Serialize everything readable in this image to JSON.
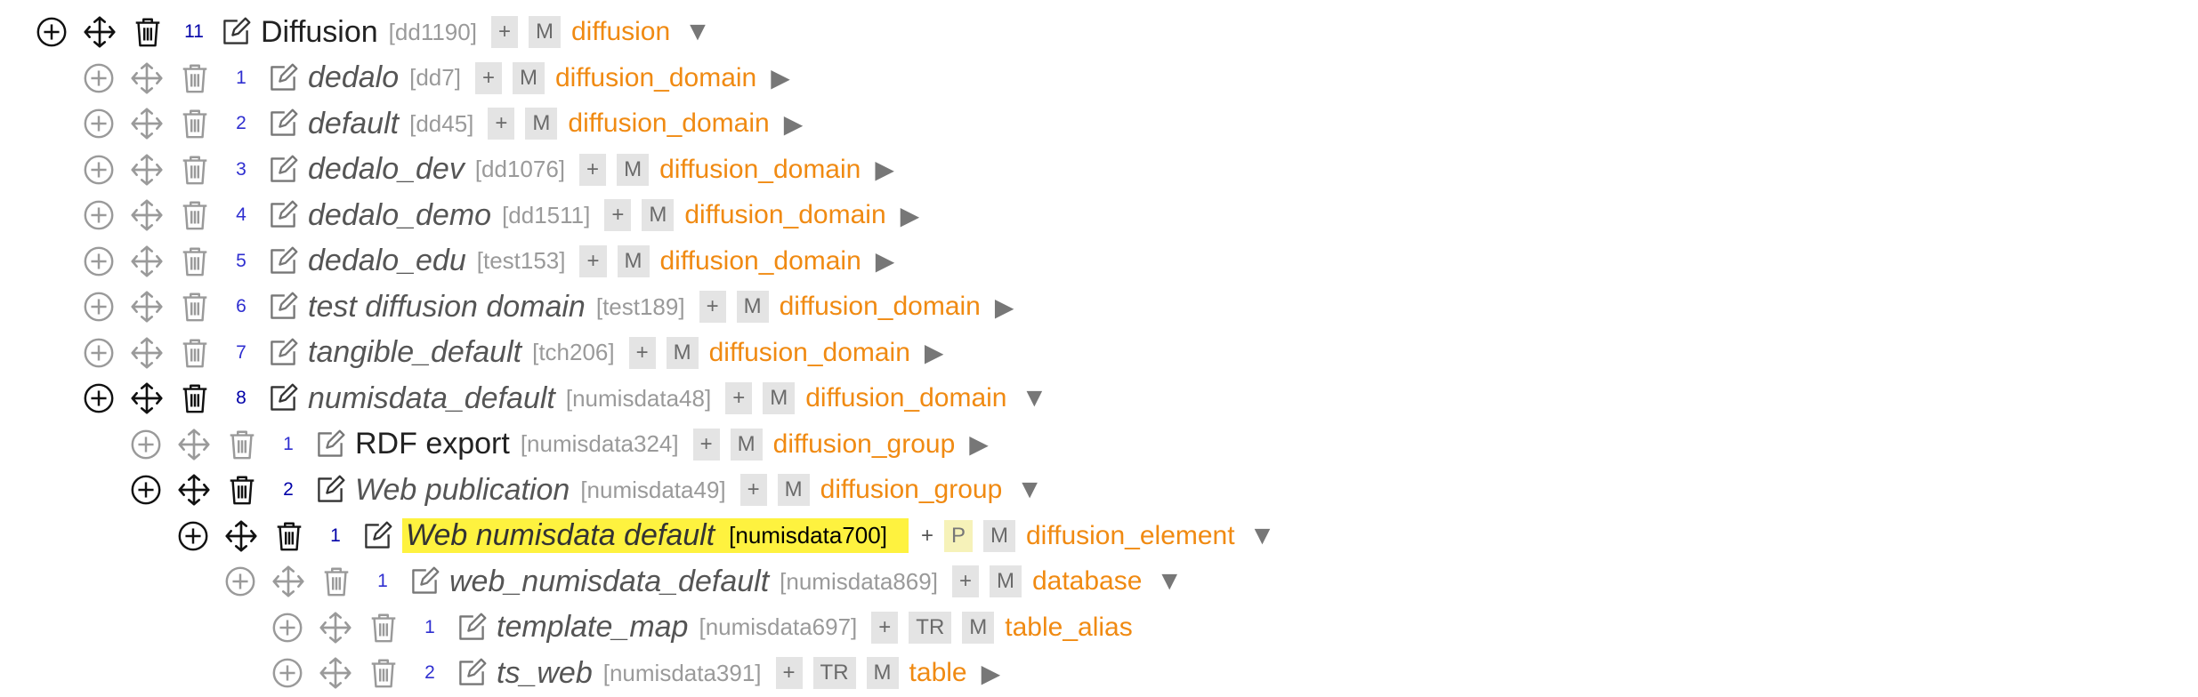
{
  "tree": {
    "rows": [
      {
        "indent": 0,
        "state": "active",
        "num": "11",
        "label": "Diffusion",
        "style": "plain",
        "tid": "[dd1190]",
        "badges": [
          "+",
          "M"
        ],
        "model": "diffusion",
        "arrow": "▼"
      },
      {
        "indent": 1,
        "state": "faded",
        "num": "1",
        "label": "dedalo",
        "style": "italic",
        "tid": "[dd7]",
        "badges": [
          "+",
          "M"
        ],
        "model": "diffusion_domain",
        "arrow": "▶"
      },
      {
        "indent": 1,
        "state": "faded",
        "num": "2",
        "label": "default",
        "style": "italic",
        "tid": "[dd45]",
        "badges": [
          "+",
          "M"
        ],
        "model": "diffusion_domain",
        "arrow": "▶"
      },
      {
        "indent": 1,
        "state": "faded",
        "num": "3",
        "label": "dedalo_dev",
        "style": "italic",
        "tid": "[dd1076]",
        "badges": [
          "+",
          "M"
        ],
        "model": "diffusion_domain",
        "arrow": "▶"
      },
      {
        "indent": 1,
        "state": "faded",
        "num": "4",
        "label": "dedalo_demo",
        "style": "italic",
        "tid": "[dd1511]",
        "badges": [
          "+",
          "M"
        ],
        "model": "diffusion_domain",
        "arrow": "▶"
      },
      {
        "indent": 1,
        "state": "faded",
        "num": "5",
        "label": "dedalo_edu",
        "style": "italic",
        "tid": "[test153]",
        "badges": [
          "+",
          "M"
        ],
        "model": "diffusion_domain",
        "arrow": "▶"
      },
      {
        "indent": 1,
        "state": "faded",
        "num": "6",
        "label": "test diffusion domain",
        "style": "italic",
        "tid": "[test189]",
        "badges": [
          "+",
          "M"
        ],
        "model": "diffusion_domain",
        "arrow": "▶"
      },
      {
        "indent": 1,
        "state": "faded",
        "num": "7",
        "label": "tangible_default",
        "style": "italic",
        "tid": "[tch206]",
        "badges": [
          "+",
          "M"
        ],
        "model": "diffusion_domain",
        "arrow": "▶"
      },
      {
        "indent": 1,
        "state": "active",
        "num": "8",
        "label": "numisdata_default",
        "style": "italic",
        "tid": "[numisdata48]",
        "badges": [
          "+",
          "M"
        ],
        "model": "diffusion_domain",
        "arrow": "▼"
      },
      {
        "indent": 2,
        "state": "faded",
        "num": "1",
        "label": "RDF export",
        "style": "plain",
        "tid": "[numisdata324]",
        "badges": [
          "+",
          "M"
        ],
        "model": "diffusion_group",
        "arrow": "▶"
      },
      {
        "indent": 2,
        "state": "active",
        "num": "2",
        "label": "Web publication",
        "style": "italic",
        "tid": "[numisdata49]",
        "badges": [
          "+",
          "M"
        ],
        "model": "diffusion_group",
        "arrow": "▼"
      },
      {
        "indent": 3,
        "state": "active",
        "num": "1",
        "label": "Web numisdata default",
        "style": "italic",
        "tid": "[numisdata700]",
        "badges": [
          "+",
          "P",
          "M"
        ],
        "model": "diffusion_element",
        "arrow": "▼",
        "highlight": true
      },
      {
        "indent": 4,
        "state": "faded",
        "num": "1",
        "label": "web_numisdata_default",
        "style": "italic",
        "tid": "[numisdata869]",
        "badges": [
          "+",
          "M"
        ],
        "model": "database",
        "arrow": "▼"
      },
      {
        "indent": 5,
        "state": "faded",
        "num": "1",
        "label": "template_map",
        "style": "italic",
        "tid": "[numisdata697]",
        "badges": [
          "+",
          "TR",
          "M"
        ],
        "model": "table_alias",
        "arrow": ""
      },
      {
        "indent": 5,
        "state": "faded",
        "num": "2",
        "label": "ts_web",
        "style": "italic",
        "tid": "[numisdata391]",
        "badges": [
          "+",
          "TR",
          "M"
        ],
        "model": "table",
        "arrow": "▶"
      }
    ]
  },
  "colors": {
    "model_text": "#f08a12",
    "highlight": "#fef23f",
    "badge_bg": "#e4e4e4",
    "tree_number": "#2f2fd0"
  },
  "icons": [
    "add-circle-icon",
    "move-icon",
    "trash-icon",
    "edit-icon",
    "expand-arrow-icon"
  ]
}
